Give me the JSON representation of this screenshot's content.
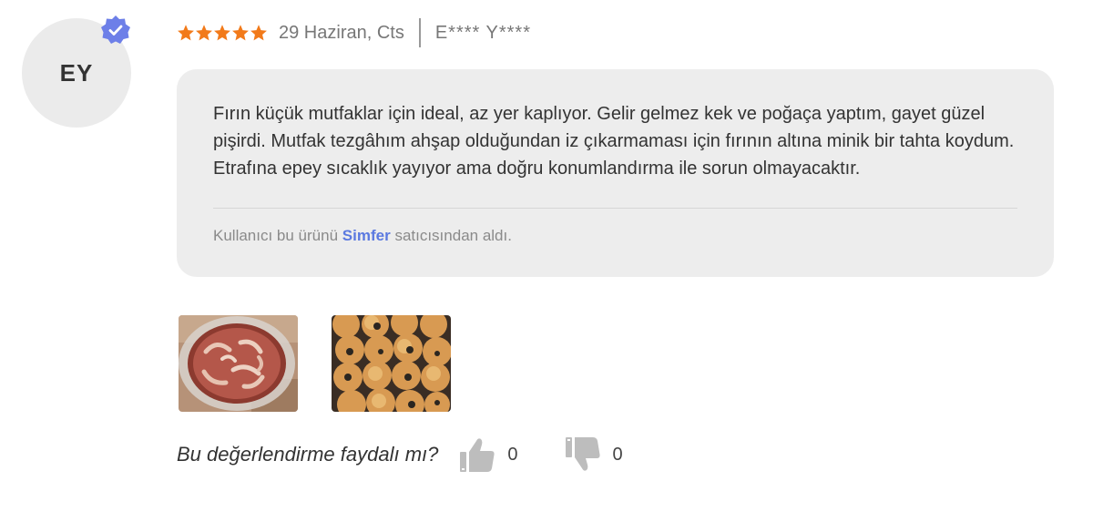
{
  "review": {
    "initials": "EY",
    "rating": 5,
    "date": "29 Haziran, Cts",
    "author": "E**** Y****",
    "text": "Fırın küçük mutfaklar için ideal, az yer kaplıyor. Gelir gelmez kek ve poğaça yaptım, gayet güzel pişirdi. Mutfak tezgâhım ahşap olduğundan iz çıkarmaması için fırının altına minik bir tahta koydum. Etrafına epey sıcaklık yayıyor ama doğru konumlandırma ile sorun olmayacaktır.",
    "seller_prefix": "Kullanıcı bu ürünü",
    "seller_name": "Simfer",
    "seller_suffix": "satıcısından aldı.",
    "photos": [
      "cake-photo",
      "buns-photo"
    ]
  },
  "helpful": {
    "question": "Bu değerlendirme faydalı mı?",
    "likes": "0",
    "dislikes": "0"
  },
  "colors": {
    "star": "#f27a1a",
    "badge": "#6d7fe8",
    "seller_link": "#5b79e0",
    "bubble_bg": "#ededed",
    "avatar_bg": "#ebebeb",
    "thumb_icon": "#bdbdbd"
  }
}
